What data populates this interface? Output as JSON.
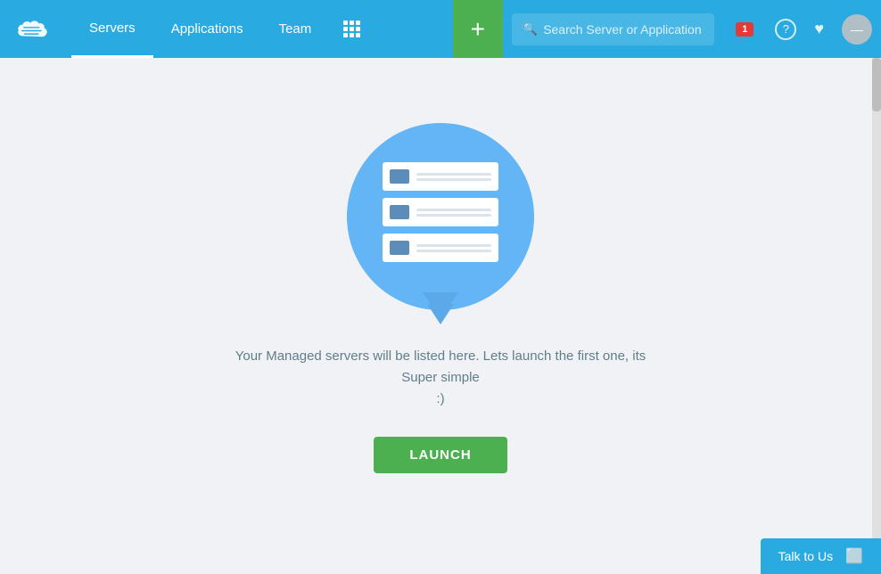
{
  "navbar": {
    "logo_alt": "CloudWays Logo",
    "links": [
      {
        "label": "Servers",
        "active": true
      },
      {
        "label": "Applications",
        "active": false
      },
      {
        "label": "Team",
        "active": false
      }
    ],
    "add_btn_label": "+",
    "search_placeholder": "Search Server or Application",
    "notification_count": "1",
    "help_icon": "?",
    "favorites_icon": "♥",
    "avatar_initial": ""
  },
  "main": {
    "empty_message_line1": "Your Managed servers will be listed here. Lets launch the first one, its Super simple",
    "empty_message_line2": ":)",
    "launch_btn_label": "LAUNCH"
  },
  "chat": {
    "label": "Talk to Us"
  }
}
